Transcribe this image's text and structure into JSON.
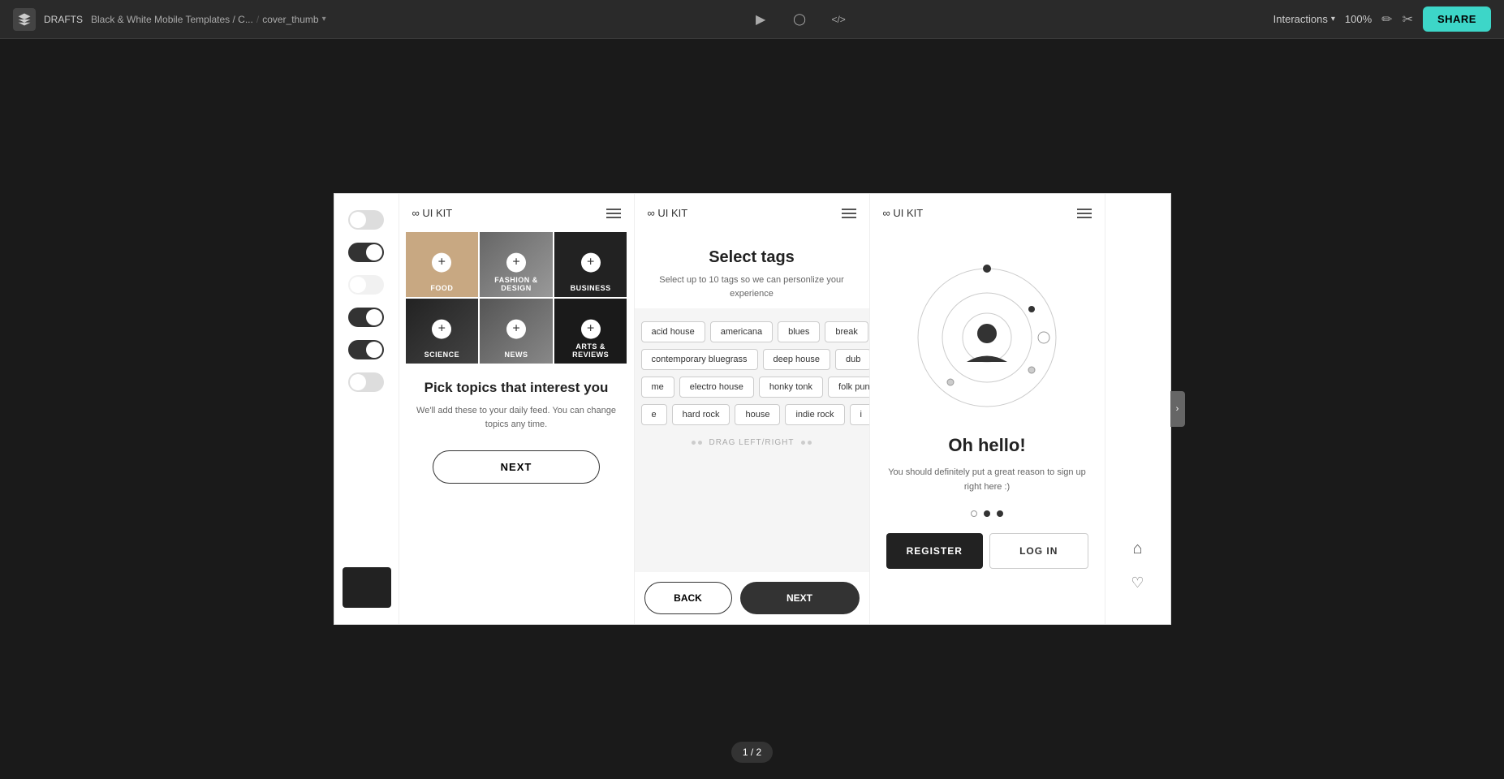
{
  "topbar": {
    "logo_label": "Drafts",
    "project_name": "DRAFTS",
    "breadcrumb_1": "Black & White Mobile Templates / C...",
    "breadcrumb_2": "cover_thumb",
    "play_icon": "▶",
    "chat_icon": "○",
    "code_icon": "<>",
    "interactions_label": "Interactions",
    "zoom_label": "100%",
    "share_label": "SHARE"
  },
  "frame1": {
    "logo": "∞ UI KIT",
    "menu_label": "menu",
    "cells": [
      {
        "label": "FOOD",
        "bg": "bg-gray1"
      },
      {
        "label": "FASHION & DESIGN",
        "bg": "bg-gray2"
      },
      {
        "label": "BUSINESS",
        "bg": "bg-dark"
      },
      {
        "label": "SCIENCE",
        "bg": "bg-dark2"
      },
      {
        "label": "NEWS",
        "bg": "bg-medium"
      },
      {
        "label": "ARTS & REVIEWS",
        "bg": "bg-dark3"
      }
    ],
    "title": "Pick topics that interest you",
    "subtitle": "We'll add these to your daily feed. You can change topics any time.",
    "next_label": "NEXT"
  },
  "frame2": {
    "logo": "∞ UI KIT",
    "title": "Select tags",
    "subtitle": "Select up to 10 tags so we can personlize your experience",
    "tags_row1": [
      "acid house",
      "americana",
      "blues",
      "break"
    ],
    "tags_row2": [
      "contemporary bluegrass",
      "deep house",
      "dub"
    ],
    "tags_row3": [
      "me",
      "electro house",
      "honky tonk",
      "folk punk"
    ],
    "tags_row4": [
      "e",
      "hard rock",
      "house",
      "indie rock",
      "i"
    ],
    "drag_hint": "DRAG LEFT/RIGHT",
    "back_label": "BACK",
    "next_label": "NEXT"
  },
  "frame3": {
    "logo": "∞ UI KIT",
    "title": "Oh hello!",
    "subtitle": "You should definitely put a great reason to sign up right here :)",
    "dots": [
      false,
      true,
      true
    ],
    "register_label": "REGISTER",
    "login_label": "LOG IN"
  },
  "page_indicator": "1 / 2"
}
